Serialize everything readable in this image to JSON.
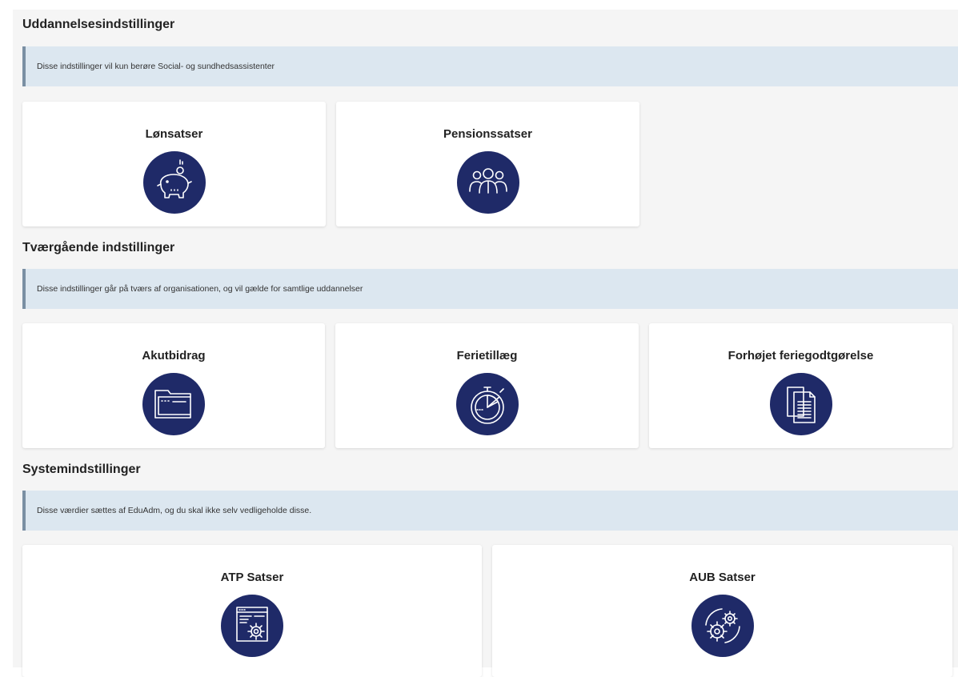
{
  "sections": [
    {
      "title": "Uddannelsesindstillinger",
      "info": "Disse indstillinger vil kun berøre Social- og sundhedsassistenter",
      "cards": [
        {
          "title": "Lønsatser",
          "icon": "piggy-bank-icon"
        },
        {
          "title": "Pensionssatser",
          "icon": "people-group-icon"
        }
      ]
    },
    {
      "title": "Tværgående indstillinger",
      "info": "Disse indstillinger går på tværs af organisationen, og vil gælde for samtlige uddannelser",
      "cards": [
        {
          "title": "Akutbidrag",
          "icon": "folder-icon"
        },
        {
          "title": "Ferietillæg",
          "icon": "stopwatch-chart-icon"
        },
        {
          "title": "Forhøjet feriegodtgørelse",
          "icon": "documents-icon"
        }
      ]
    },
    {
      "title": "Systemindstillinger",
      "info": "Disse værdier sættes af EduAdm, og du skal ikke selv vedligeholde disse.",
      "cards": [
        {
          "title": "ATP Satser",
          "icon": "browser-gear-icon"
        },
        {
          "title": "AUB Satser",
          "icon": "gears-icon"
        }
      ]
    }
  ],
  "colors": {
    "icon_background": "#1f2a68",
    "info_background": "#dce7f0",
    "info_border": "#7a8fa3",
    "page_background": "#f5f5f5"
  }
}
